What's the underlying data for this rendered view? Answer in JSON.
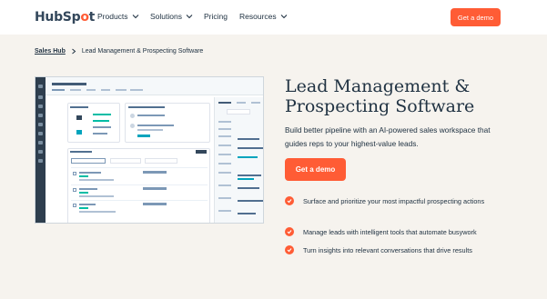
{
  "nav": {
    "logo_main": "HubSp",
    "logo_end": "t",
    "products": "Products",
    "solutions": "Solutions",
    "pricing": "Pricing",
    "resources": "Resources",
    "cta": "Get a demo"
  },
  "breadcrumb": {
    "parent": "Sales Hub",
    "current": "Lead Management & Prospecting Software"
  },
  "hero": {
    "title_line1": "Lead Management &",
    "title_line2": "Prospecting Software",
    "description": "Build better pipeline with an AI-powered sales workspace that guides reps to your highest-value leads.",
    "cta": "Get a demo",
    "bullets": [
      "Surface and prioritize your most impactful prospecting actions",
      "Manage leads with intelligent tools that automate busywork",
      "Turn insights into relevant conversations that drive results"
    ]
  },
  "colors": {
    "accent": "#ff5c35",
    "text": "#213343",
    "background": "#f6f3ee"
  }
}
